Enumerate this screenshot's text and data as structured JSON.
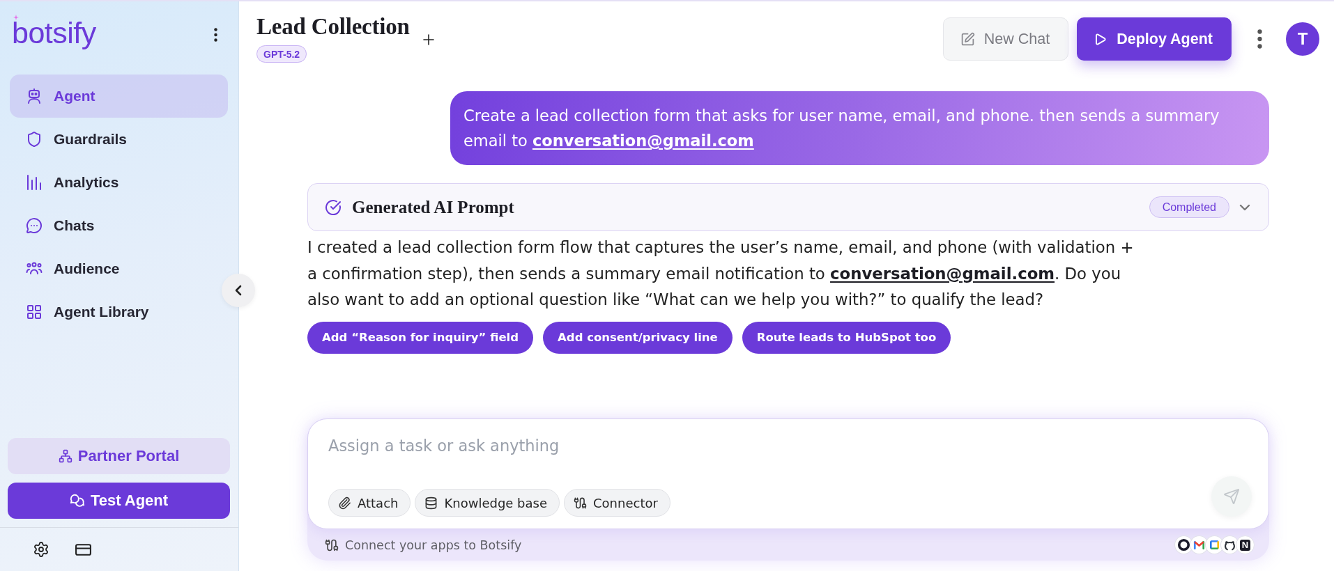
{
  "sidebar": {
    "logo": "botsify",
    "nav_items": [
      {
        "label": "Agent",
        "selected": true
      },
      {
        "label": "Guardrails",
        "selected": false
      },
      {
        "label": "Analytics",
        "selected": false
      },
      {
        "label": "Chats",
        "selected": false
      },
      {
        "label": "Audience",
        "selected": false
      },
      {
        "label": "Agent Library",
        "selected": false
      }
    ],
    "partner_button": "Partner Portal",
    "test_button": "Test Agent"
  },
  "header": {
    "title": "Lead Collection",
    "model_badge": "GPT-5.2",
    "new_chat_button": {
      "label": "New Chat",
      "disabled": true
    },
    "deploy_button": "Deploy Agent",
    "avatar_initial": "T"
  },
  "conversation": {
    "user_message": [
      {
        "kind": "text",
        "value": "Create a lead collection form that asks for user name, email, and phone. then sends a summary email to "
      },
      {
        "kind": "link",
        "value": "conversation@gmail.com"
      }
    ],
    "prompt_card": {
      "title": "Generated AI Prompt",
      "status": "Completed",
      "expanded": false
    },
    "reply": [
      {
        "kind": "text",
        "value": "I created a lead collection form flow that captures the user’s name, email, and phone (with validation + a confirmation step), then sends a summary email notification to "
      },
      {
        "kind": "link",
        "value": "conversation@gmail.com"
      },
      {
        "kind": "text",
        "value": ". Do you also want to add an optional question like “What can we help you with?” to qualify the lead?"
      }
    ],
    "suggestions": [
      "Add “Reason for inquiry” field",
      "Add consent/privacy line",
      "Route leads to HubSpot too"
    ]
  },
  "composer": {
    "placeholder": "Assign a task or ask anything",
    "tools": [
      "Attach",
      "Knowledge base",
      "Connector"
    ],
    "send_button": {
      "disabled": true
    },
    "connect_text": "Connect your apps to Botsify",
    "logo_letter": "N"
  }
}
